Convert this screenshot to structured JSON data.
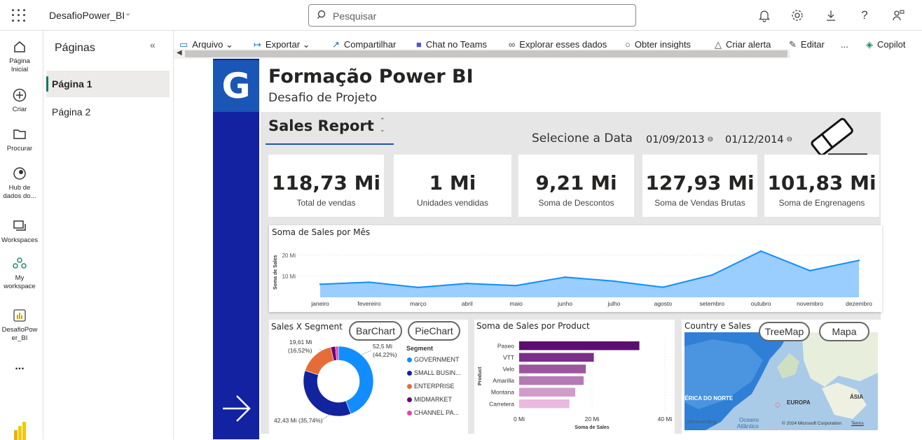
{
  "header": {
    "workspace_name": "DesafioPower_BI",
    "search_placeholder": "Pesquisar"
  },
  "rail": {
    "items": [
      {
        "label1": "Página",
        "label2": "Inicial",
        "icon": "home-icon"
      },
      {
        "label1": "Criar",
        "label2": "",
        "icon": "plus-circle-icon"
      },
      {
        "label1": "Procurar",
        "label2": "",
        "icon": "folder-icon"
      },
      {
        "label1": "Hub de",
        "label2": "dados do...",
        "icon": "data-hub-icon"
      },
      {
        "label1": "Workspaces",
        "label2": "",
        "icon": "workspaces-icon"
      },
      {
        "label1": "My",
        "label2": "workspace",
        "icon": "my-workspace-icon"
      },
      {
        "label1": "DesafioPow",
        "label2": "er_BI",
        "icon": "report-icon"
      }
    ],
    "more": "..."
  },
  "pages_pane": {
    "title": "Páginas",
    "pages": [
      "Página 1",
      "Página 2"
    ]
  },
  "toolbar": {
    "items": [
      "Arquivo",
      "Exportar",
      "Compartilhar",
      "Chat no Teams",
      "Explorar esses dados",
      "Obter insights",
      "Criar alerta",
      "Editar",
      "...",
      "Copilot"
    ]
  },
  "report": {
    "logo_letter": "G",
    "title": "Formação Power BI",
    "subtitle": "Desafio de Projeto",
    "section_title": "Sales Report",
    "date_label": "Selecione a Data",
    "date_start": "01/09/2013",
    "date_end": "01/12/2014",
    "kpis": [
      {
        "value": "118,73 Mi",
        "label": "Total de vendas"
      },
      {
        "value": "1 Mi",
        "label": "Unidades vendidas"
      },
      {
        "value": "9,21 Mi",
        "label": "Soma de Descontos"
      },
      {
        "value": "127,93 Mi",
        "label": "Soma de Vendas Brutas"
      },
      {
        "value": "101,83 Mi",
        "label": "Soma de Engrenagens"
      }
    ],
    "buttons": {
      "bar": "BarChart",
      "pie": "PieChart",
      "tree": "TreeMap",
      "map": "Mapa"
    },
    "map": {
      "title": "Country e Sales",
      "labels": {
        "na": "IÉRICA DO NORTE",
        "eu": "EUROPA",
        "asia": "ÁSIA",
        "ocean1": "Oceano",
        "ocean2": "Atlântico"
      },
      "attribution": "© 2024 Microsoft Corporation",
      "terms": "Terms",
      "bing": "Microsoft Bing"
    }
  },
  "chart_data": [
    {
      "type": "area",
      "title": "Soma de Sales por Mês",
      "ylabel": "Soma de Sales",
      "xlabel": "",
      "categories": [
        "janeiro",
        "fevereiro",
        "março",
        "abril",
        "maio",
        "junho",
        "julho",
        "agosto",
        "setembro",
        "outubro",
        "novembro",
        "dezembro"
      ],
      "values": [
        6.2,
        7.2,
        4.7,
        6.6,
        5.6,
        9.6,
        7.7,
        4.8,
        10.6,
        22.0,
        12.7,
        17.6
      ],
      "yticks": [
        "10 Mi",
        "20 Mi"
      ],
      "ytick_values": [
        10,
        20
      ],
      "ylim": [
        0,
        25
      ],
      "color": "#118dff",
      "fill": "#8ec9ff"
    },
    {
      "type": "pie",
      "title": "Sales X Segment",
      "legend_title": "Segment",
      "donut": true,
      "slices": [
        {
          "name": "GOVERNMENT",
          "value": 52.5,
          "pct": 44.22,
          "color": "#118dff"
        },
        {
          "name": "SMALL BUSIN...",
          "value": 42.43,
          "pct": 35.74,
          "color": "#12239e"
        },
        {
          "name": "ENTERPRISE",
          "value": 19.61,
          "pct": 16.52,
          "color": "#e66c37"
        },
        {
          "name": "MIDMARKET",
          "value": 2.6,
          "pct": 2.19,
          "color": "#6b007b"
        },
        {
          "name": "CHANNEL PA...",
          "value": 1.59,
          "pct": 1.33,
          "color": "#e044a7"
        }
      ],
      "data_labels": [
        "52,5 Mi",
        "(44,22%)",
        "42,43 Mi (35,74%)",
        "19,61 Mi",
        "(16,52%)"
      ]
    },
    {
      "type": "bar",
      "orientation": "horizontal",
      "title": "Soma de Sales por Product",
      "xlabel": "Soma de Sales",
      "ylabel": "Product",
      "categories": [
        "Paseo",
        "VTT",
        "Velo",
        "Amarilla",
        "Montana",
        "Carretera"
      ],
      "values": [
        33.0,
        20.5,
        18.3,
        17.7,
        15.4,
        13.8
      ],
      "colors": [
        "#5a0f6e",
        "#7a2f88",
        "#9c569e",
        "#b47ab4",
        "#cf9ccc",
        "#e9b9df"
      ],
      "xticks": [
        "0 Mi",
        "20 Mi",
        "40 Mi"
      ],
      "xtick_values": [
        0,
        20,
        40
      ],
      "xlim": [
        0,
        40
      ]
    }
  ]
}
